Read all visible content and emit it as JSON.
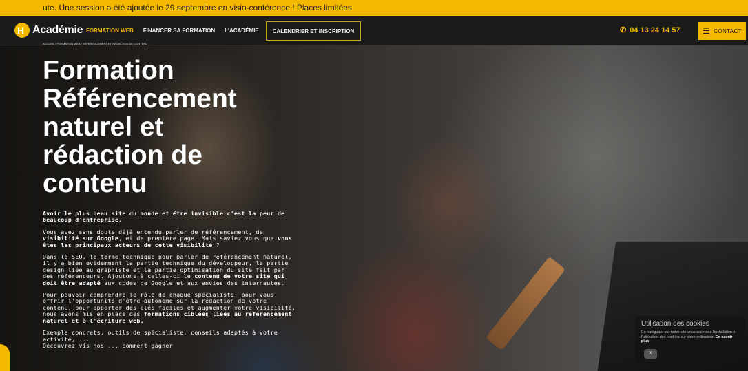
{
  "ticker": {
    "text": "ute. Une session a été ajoutée le 29 septembre en visio-conférence ! Places limitées"
  },
  "header": {
    "logo": {
      "mark": "H",
      "text": "Académie"
    },
    "menu": [
      {
        "label": "FORMATION WEB"
      },
      {
        "label": "FINANCER SA FORMATION"
      },
      {
        "label": "L'ACADÉMIE"
      },
      {
        "label": "CALENDRIER ET INSCRIPTION"
      }
    ],
    "phone": "04 13 24 14 57",
    "contact_label": "CONTACT"
  },
  "hero": {
    "breadcrumb": "ACCUEIL / FORMATION WEB / RÉFÉRENCEMENT ET RÉDACTION DE CONTENU",
    "title": "Formation Référencement naturel et rédaction de contenu",
    "p1": "Avoir le plus beau site du monde et être invisible c'est la peur de beaucoup d'entreprise.",
    "p2": {
      "a": "Vous avez sans doute déjà entendu parler de référencement, de ",
      "b": "visibilité sur Google",
      "c": ", et de première page. Mais saviez vous que ",
      "d": "vous êtes les principaux acteurs de cette visibilité",
      "e": " ?"
    },
    "p3": {
      "a": "Dans le SEO, le terme technique pour parler de référencement naturel, il y a bien evidemment la partie technique du développeur, la partie design liée au graphiste et la partie optimisation du site fait par des référenceurs. Ajoutons à celles-ci le ",
      "b": "contenu de votre site qui doit être adapté",
      "c": " aux codes de Google et aux envies des internautes."
    },
    "p4": {
      "a": "Pour pouvoir comprendre le rôle de chaque spécialiste, pour vous offrir l'opportunité d'être autonome sur la rédaction de votre contenu, pour apporter des clés faciles et augmenter votre visibilité, nous avons mis en place des ",
      "b": "formations ciblées liées au référencement naturel et à l'écriture web."
    },
    "p5": "Exemple concrets, outils de spécialiste, conseils adaptés à votre activité, ...",
    "p6": "Découvrez vis nos ... comment gagner"
  },
  "cookie": {
    "title": "Utilisation des cookies",
    "text": "En naviguant sur notre site vous acceptez l'installation et l'utilisation des cookies sur votre ordinateur.",
    "link": "En savoir plus",
    "close": "X"
  },
  "colors": {
    "accent": "#f5b800",
    "nav_bg": "#1b1b1b"
  }
}
